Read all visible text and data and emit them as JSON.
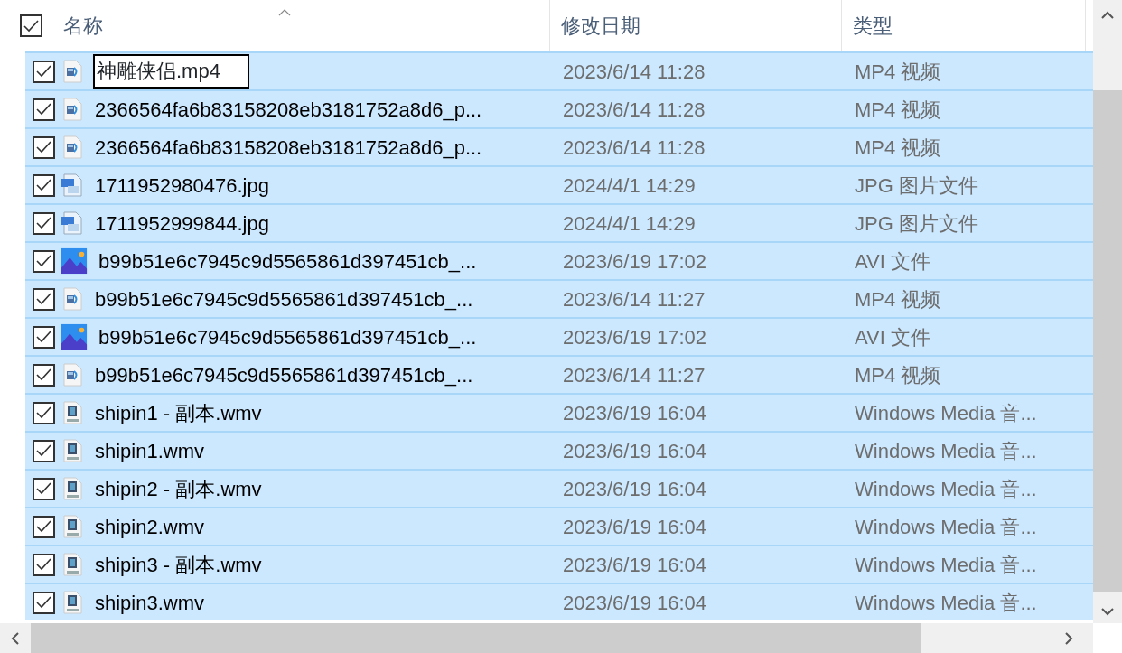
{
  "header": {
    "select_all_checked": true,
    "columns": [
      {
        "label": "名称",
        "sorted": true
      },
      {
        "label": "修改日期",
        "sorted": false
      },
      {
        "label": "类型",
        "sorted": false
      }
    ]
  },
  "rows": [
    {
      "kind": "video",
      "name": "神雕侠侣.mp4",
      "date": "2023/6/14 11:28",
      "type": "MP4 视频",
      "checked": true,
      "selected": true,
      "editing": true
    },
    {
      "kind": "video",
      "name": "2366564fa6b83158208eb3181752a8d6_p...",
      "date": "2023/6/14 11:28",
      "type": "MP4 视频",
      "checked": true,
      "selected": true,
      "editing": false
    },
    {
      "kind": "video",
      "name": "2366564fa6b83158208eb3181752a8d6_p...",
      "date": "2023/6/14 11:28",
      "type": "MP4 视频",
      "checked": true,
      "selected": true,
      "editing": false
    },
    {
      "kind": "jpg",
      "name": "1711952980476.jpg",
      "date": "2024/4/1 14:29",
      "type": "JPG 图片文件",
      "checked": true,
      "selected": true,
      "editing": false
    },
    {
      "kind": "jpg",
      "name": "1711952999844.jpg",
      "date": "2024/4/1 14:29",
      "type": "JPG 图片文件",
      "checked": true,
      "selected": true,
      "editing": false
    },
    {
      "kind": "picture",
      "name": "b99b51e6c7945c9d5565861d397451cb_...",
      "date": "2023/6/19 17:02",
      "type": "AVI 文件",
      "checked": true,
      "selected": true,
      "editing": false
    },
    {
      "kind": "video",
      "name": "b99b51e6c7945c9d5565861d397451cb_...",
      "date": "2023/6/14 11:27",
      "type": "MP4 视频",
      "checked": true,
      "selected": true,
      "editing": false
    },
    {
      "kind": "picture",
      "name": "b99b51e6c7945c9d5565861d397451cb_...",
      "date": "2023/6/19 17:02",
      "type": "AVI 文件",
      "checked": true,
      "selected": true,
      "editing": false
    },
    {
      "kind": "video",
      "name": "b99b51e6c7945c9d5565861d397451cb_...",
      "date": "2023/6/14 11:27",
      "type": "MP4 视频",
      "checked": true,
      "selected": true,
      "editing": false
    },
    {
      "kind": "wmv",
      "name": "shipin1 - 副本.wmv",
      "date": "2023/6/19 16:04",
      "type": "Windows Media 音...",
      "checked": true,
      "selected": true,
      "editing": false
    },
    {
      "kind": "wmv",
      "name": "shipin1.wmv",
      "date": "2023/6/19 16:04",
      "type": "Windows Media 音...",
      "checked": true,
      "selected": true,
      "editing": false
    },
    {
      "kind": "wmv",
      "name": "shipin2 - 副本.wmv",
      "date": "2023/6/19 16:04",
      "type": "Windows Media 音...",
      "checked": true,
      "selected": true,
      "editing": false
    },
    {
      "kind": "wmv",
      "name": "shipin2.wmv",
      "date": "2023/6/19 16:04",
      "type": "Windows Media 音...",
      "checked": true,
      "selected": true,
      "editing": false
    },
    {
      "kind": "wmv",
      "name": "shipin3 - 副本.wmv",
      "date": "2023/6/19 16:04",
      "type": "Windows Media 音...",
      "checked": true,
      "selected": true,
      "editing": false
    },
    {
      "kind": "wmv",
      "name": "shipin3.wmv",
      "date": "2023/6/19 16:04",
      "type": "Windows Media 音...",
      "checked": true,
      "selected": true,
      "editing": false
    }
  ]
}
